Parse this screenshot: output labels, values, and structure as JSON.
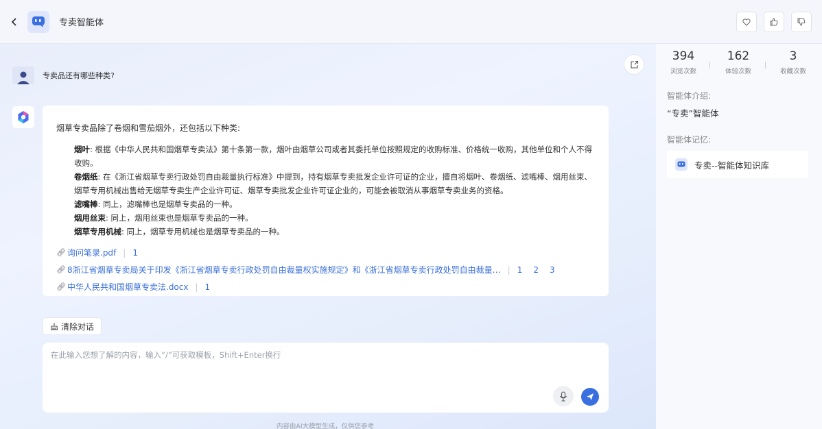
{
  "header": {
    "agent_name": "专卖智能体",
    "back_icon": "chevron-left-icon",
    "actions": [
      "heart-icon",
      "thumbs-up-icon",
      "thumbs-down-icon"
    ]
  },
  "chat": {
    "user_question": "专卖品还有哪些种类?",
    "answer": {
      "intro": "烟草专卖品除了卷烟和雪茄烟外，还包括以下种类:",
      "items": [
        {
          "term": "烟叶",
          "text": ": 根据《中华人民共和国烟草专卖法》第十条第一款，烟叶由烟草公司或者其委托单位按照规定的收购标准、价格统一收购，其他单位和个人不得收购。"
        },
        {
          "term": "卷烟纸",
          "text": ": 在《浙江省烟草专卖行政处罚自由裁量执行标准》中提到，持有烟草专卖批发企业许可证的企业，擅自将烟叶、卷烟纸、滤嘴棒、烟用丝束、烟草专用机械出售给无烟草专卖生产企业许可证、烟草专卖批发企业许可证企业的，可能会被取消从事烟草专卖业务的资格。"
        },
        {
          "term": "滤嘴棒",
          "text": ": 同上，滤嘴棒也是烟草专卖品的一种。"
        },
        {
          "term": "烟用丝束",
          "text": ": 同上，烟用丝束也是烟草专卖品的一种。"
        },
        {
          "term": "烟草专用机械",
          "text": ": 同上，烟草专用机械也是烟草专卖品的一种。"
        }
      ],
      "references": [
        {
          "name": "询问笔录.pdf",
          "pages": [
            "1"
          ]
        },
        {
          "name": "8浙江省烟草专卖局关于印发《浙江省烟草专卖行政处罚自由裁量权实施规定》和《浙江省烟草专卖行政处罚自由裁量…",
          "pages": [
            "1",
            "2",
            "3"
          ]
        },
        {
          "name": "中华人民共和国烟草专卖法.docx",
          "pages": [
            "1"
          ]
        }
      ]
    },
    "clear_label": "清除对话",
    "input_placeholder": "在此输入您想了解的内容，输入“/”可获取模板，Shift+Enter换行",
    "disclaimer": "内容由AI大模型生成，仅供您参考"
  },
  "panel": {
    "stats": [
      {
        "value": "394",
        "label": "浏览次数"
      },
      {
        "value": "162",
        "label": "体验次数"
      },
      {
        "value": "3",
        "label": "收藏次数"
      }
    ],
    "intro_title": "智能体介绍:",
    "intro_text": "“专卖”智能体",
    "memory_title": "智能体记忆:",
    "knowledge_base": "专卖--智能体知识库"
  },
  "colors": {
    "accent": "#3a6fe0",
    "link": "#3a6fd8"
  }
}
